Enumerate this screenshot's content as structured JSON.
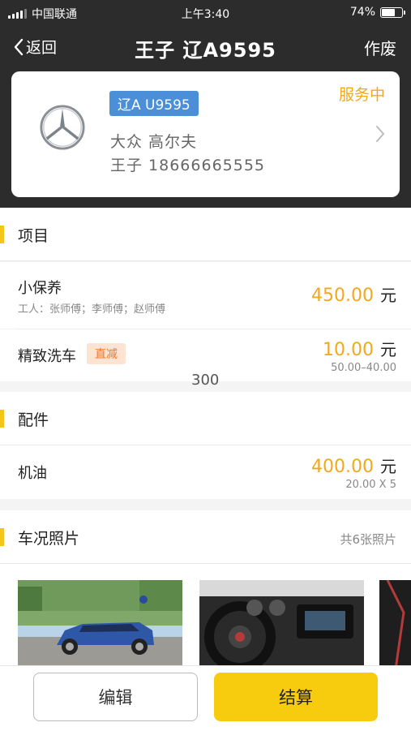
{
  "status_bar": {
    "carrier": "中国联通",
    "time": "上午3:40",
    "battery": "74%",
    "battery_level": 0.74
  },
  "nav": {
    "back_label": "返回",
    "title": "王子  辽A9595",
    "action_label": "作废"
  },
  "vehicle_card": {
    "brand_icon": "mercedes-benz-logo",
    "plate": "辽A U9595",
    "status": "服务中",
    "model": "大众 高尔夫",
    "owner": "王子 18666665555"
  },
  "services_section": {
    "title": "项目",
    "items": [
      {
        "name": "小保养",
        "workers": "工人：张师傅；李师傅；赵师傅",
        "amount": "450.00",
        "unit": "元"
      },
      {
        "name": "精致洗车",
        "tag": "直减",
        "amount": "10.00",
        "unit": "元",
        "detail": "50.00–40.00"
      }
    ]
  },
  "overlay_text": "300",
  "parts_section": {
    "title": "配件",
    "items": [
      {
        "name": "机油",
        "amount": "400.00",
        "unit": "元",
        "detail": "20.00 X 5"
      }
    ]
  },
  "photos_section": {
    "title": "车况照片",
    "count_label": "共6张照片"
  },
  "footer": {
    "edit_label": "编辑",
    "pay_label": "结算"
  },
  "colors": {
    "accent": "#f7cb0e",
    "price": "#f2a81d",
    "plate": "#4a8fd8",
    "header": "#2c2c2c"
  }
}
